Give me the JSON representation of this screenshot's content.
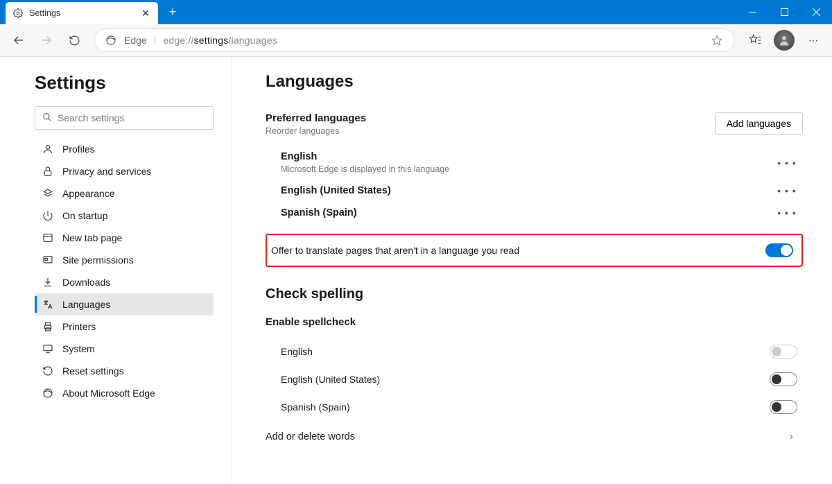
{
  "window": {
    "tab_title": "Settings"
  },
  "addressbar": {
    "app_label": "Edge",
    "url_prefix": "edge://",
    "url_mid": "settings",
    "url_suffix": "/languages"
  },
  "sidebar": {
    "heading": "Settings",
    "search_placeholder": "Search settings",
    "items": [
      {
        "label": "Profiles"
      },
      {
        "label": "Privacy and services"
      },
      {
        "label": "Appearance"
      },
      {
        "label": "On startup"
      },
      {
        "label": "New tab page"
      },
      {
        "label": "Site permissions"
      },
      {
        "label": "Downloads"
      },
      {
        "label": "Languages"
      },
      {
        "label": "Printers"
      },
      {
        "label": "System"
      },
      {
        "label": "Reset settings"
      },
      {
        "label": "About Microsoft Edge"
      }
    ]
  },
  "page": {
    "title": "Languages",
    "preferred": {
      "heading": "Preferred languages",
      "sub": "Reorder languages",
      "add_button": "Add languages",
      "items": [
        {
          "name": "English",
          "note": "Microsoft Edge is displayed in this language"
        },
        {
          "name": "English (United States)"
        },
        {
          "name": "Spanish (Spain)"
        }
      ]
    },
    "translate_label": "Offer to translate pages that aren't in a language you read",
    "spelling": {
      "heading": "Check spelling",
      "sub": "Enable spellcheck",
      "items": [
        {
          "name": "English"
        },
        {
          "name": "English (United States)"
        },
        {
          "name": "Spanish (Spain)"
        }
      ],
      "add_words": "Add or delete words"
    }
  }
}
